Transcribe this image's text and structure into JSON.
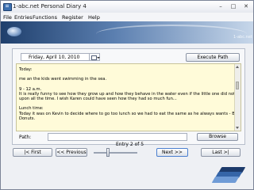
{
  "window": {
    "title": "1-abc.net Personal Diary 4"
  },
  "menu": [
    "File",
    "Entries",
    "Functions",
    "Register",
    "Help"
  ],
  "banner": {
    "brand": "1-abc.net"
  },
  "entry": {
    "date": "Friday, April 10, 2010",
    "execute_path_label": "Execute Path",
    "text_lines": [
      "Today:",
      "",
      "me an the kids went swimming in the sea.",
      "",
      "9 - 12 a.m.",
      "It is really funny to see how they grow up and how they behave in the water even if the little one did not manage to be",
      "upon all the time. I wish Karen could have seen how they had so much fun...",
      "",
      "Lunch time:",
      "Today it was on Kevin to decide where to go too lunch so we had to eat the same as he always wants - Boston Cream",
      "Donuts."
    ],
    "path_label": "Path:",
    "path_value": "",
    "browse_label": "Browse"
  },
  "navigation": {
    "entry_count": "Entry 2 of 5",
    "first_label": "|< First",
    "previous_label": "<< Previous",
    "next_label": "Next >>",
    "last_label": "Last >|"
  },
  "icons": {
    "app": "diary-app-icon",
    "calendar": "calendar-icon",
    "logo": "stack-logo-icon"
  }
}
